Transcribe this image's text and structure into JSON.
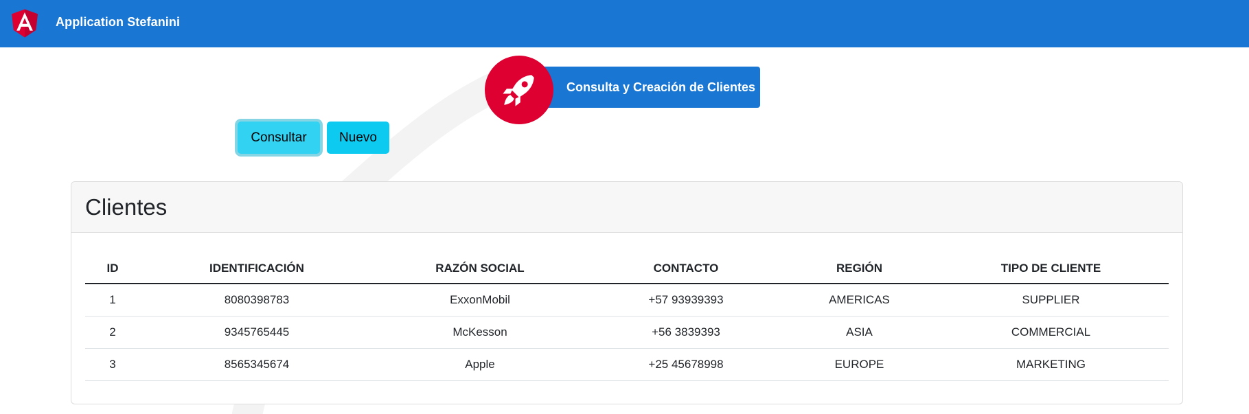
{
  "toolbar": {
    "app_title": "Application Stefanini",
    "logo_icon": "angular-logo-icon"
  },
  "banner": {
    "icon": "rocket-icon",
    "text": "Consulta y Creación de Clientes"
  },
  "actions": {
    "consultar_label": "Consultar",
    "nuevo_label": "Nuevo"
  },
  "clientes": {
    "title": "Clientes",
    "columns": [
      "ID",
      "IDENTIFICACIÓN",
      "RAZÓN SOCIAL",
      "CONTACTO",
      "REGIÓN",
      "TIPO DE CLIENTE"
    ],
    "rows": [
      [
        "1",
        "8080398783",
        "ExxonMobil",
        "+57 93939393",
        "AMERICAS",
        "SUPPLIER"
      ],
      [
        "2",
        "9345765445",
        "McKesson",
        "+56 3839393",
        "ASIA",
        "COMMERCIAL"
      ],
      [
        "3",
        "8565345674",
        "Apple",
        "+25 45678998",
        "EUROPE",
        "MARKETING"
      ]
    ]
  },
  "colors": {
    "toolbar": "#1976d2",
    "accent_red": "#dd0031",
    "button": "#0dcaf0"
  }
}
